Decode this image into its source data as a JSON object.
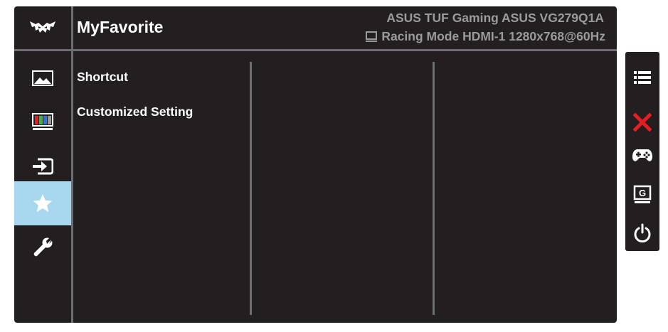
{
  "header": {
    "title": "MyFavorite",
    "model": "ASUS TUF Gaming ASUS VG279Q1A",
    "status": "Racing Mode HDMI-1 1280x768@60Hz"
  },
  "sidebar": {
    "items": [
      {
        "icon": "image-icon",
        "active": false
      },
      {
        "icon": "color-bars-icon",
        "active": false
      },
      {
        "icon": "input-select-icon",
        "active": false
      },
      {
        "icon": "star-icon",
        "active": true
      },
      {
        "icon": "wrench-icon",
        "active": false
      }
    ]
  },
  "content": {
    "items": [
      {
        "label": "Shortcut"
      },
      {
        "label": "Customized Setting"
      }
    ]
  },
  "keys": [
    {
      "icon": "menu-list-icon"
    },
    {
      "icon": "close-icon"
    },
    {
      "icon": "gamepad-icon"
    },
    {
      "icon": "gameplus-icon"
    },
    {
      "icon": "power-icon"
    }
  ],
  "colors": {
    "panel": "#231f20",
    "separator": "#6d6e71",
    "active": "#a7d8f0",
    "close": "#e31e24",
    "info_text": "#9b9b9b"
  }
}
